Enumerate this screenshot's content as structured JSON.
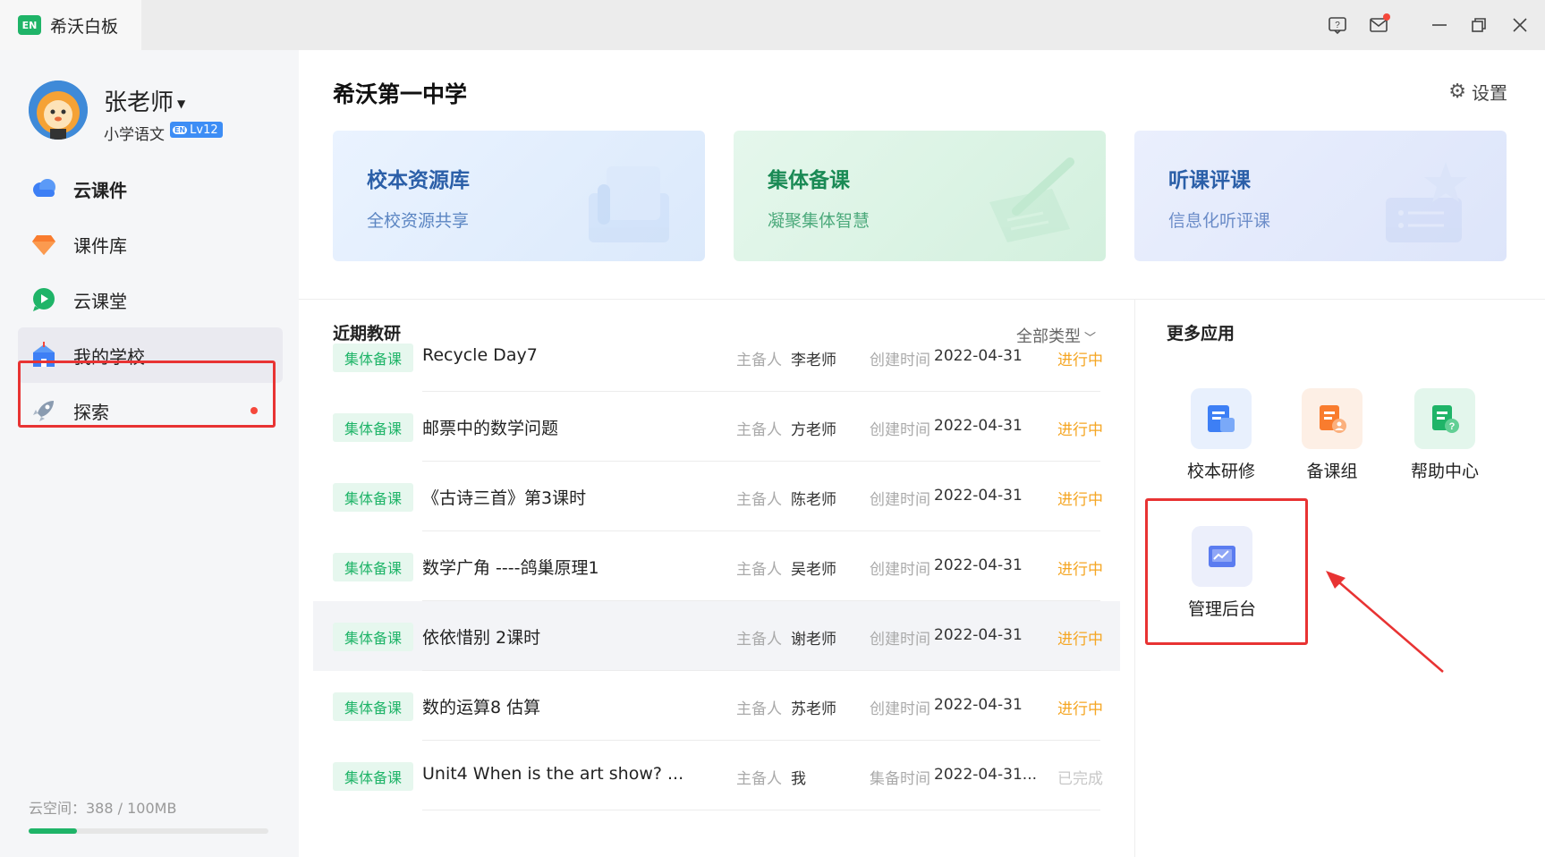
{
  "app": {
    "logo_text": "EN",
    "title": "希沃白板"
  },
  "window_controls": [
    "help-icon",
    "mail-icon",
    "minimize-icon",
    "restore-icon",
    "close-icon"
  ],
  "user": {
    "name": "张老师",
    "subject": "小学语文",
    "badge_prefix": "EN",
    "level": "Lv12"
  },
  "nav": [
    {
      "label": "云课件",
      "icon": "cloud-icon",
      "active": false,
      "bold": true
    },
    {
      "label": "课件库",
      "icon": "diamond-icon",
      "active": false,
      "bold": false
    },
    {
      "label": "云课堂",
      "icon": "play-bubble-icon",
      "active": false,
      "bold": false
    },
    {
      "label": "我的学校",
      "icon": "school-icon",
      "active": true,
      "bold": false
    },
    {
      "label": "探索",
      "icon": "rocket-icon",
      "active": false,
      "bold": false,
      "has_dot": true
    }
  ],
  "storage": {
    "text": "云空间：388 / 100MB",
    "fill_fraction": 0.2
  },
  "school": {
    "title": "希沃第一中学",
    "settings_label": "设置"
  },
  "cards": [
    {
      "title": "校本资源库",
      "subtitle": "全校资源共享",
      "color": "#2b5fa8"
    },
    {
      "title": "集体备课",
      "subtitle": "凝聚集体智慧",
      "color": "#1a8a55"
    },
    {
      "title": "听课评课",
      "subtitle": "信息化听评课",
      "color": "#2b5fa8"
    }
  ],
  "recent": {
    "title": "近期教研",
    "filter": "全部类型",
    "rows": [
      {
        "tag": "集体备课",
        "title": "Recycle Day7",
        "owner_key": "主备人",
        "owner": "李老师",
        "time_key": "创建时间",
        "time": "2022-04-31",
        "status": "进行中"
      },
      {
        "tag": "集体备课",
        "title": "邮票中的数学问题",
        "owner_key": "主备人",
        "owner": "方老师",
        "time_key": "创建时间",
        "time": "2022-04-31",
        "status": "进行中"
      },
      {
        "tag": "集体备课",
        "title": "《古诗三首》第3课时",
        "owner_key": "主备人",
        "owner": "陈老师",
        "time_key": "创建时间",
        "time": "2022-04-31",
        "status": "进行中"
      },
      {
        "tag": "集体备课",
        "title": "数学广角 ----鸽巢原理1",
        "owner_key": "主备人",
        "owner": "吴老师",
        "time_key": "创建时间",
        "time": "2022-04-31",
        "status": "进行中"
      },
      {
        "tag": "集体备课",
        "title": "依依惜别 2课时",
        "owner_key": "主备人",
        "owner": "谢老师",
        "time_key": "创建时间",
        "time": "2022-04-31",
        "status": "进行中"
      },
      {
        "tag": "集体备课",
        "title": "数的运算8  估算",
        "owner_key": "主备人",
        "owner": "苏老师",
        "time_key": "创建时间",
        "time": "2022-04-31",
        "status": "进行中"
      },
      {
        "tag": "集体备课",
        "title": "Unit4 When is the art show? ...",
        "owner_key": "主备人",
        "owner": "我",
        "time_key": "集备时间",
        "time": "2022-04-31...",
        "status": "已完成"
      }
    ]
  },
  "more_apps": {
    "title": "更多应用",
    "items": [
      {
        "label": "校本研修",
        "icon": "training-doc-icon"
      },
      {
        "label": "备课组",
        "icon": "prep-group-icon"
      },
      {
        "label": "帮助中心",
        "icon": "help-doc-icon"
      },
      {
        "label": "管理后台",
        "icon": "admin-chart-icon"
      }
    ]
  },
  "colors": {
    "brand_green": "#1fb468",
    "status_active": "#f5a623",
    "status_done": "#c8c8c8",
    "highlight_red": "#e83333"
  }
}
